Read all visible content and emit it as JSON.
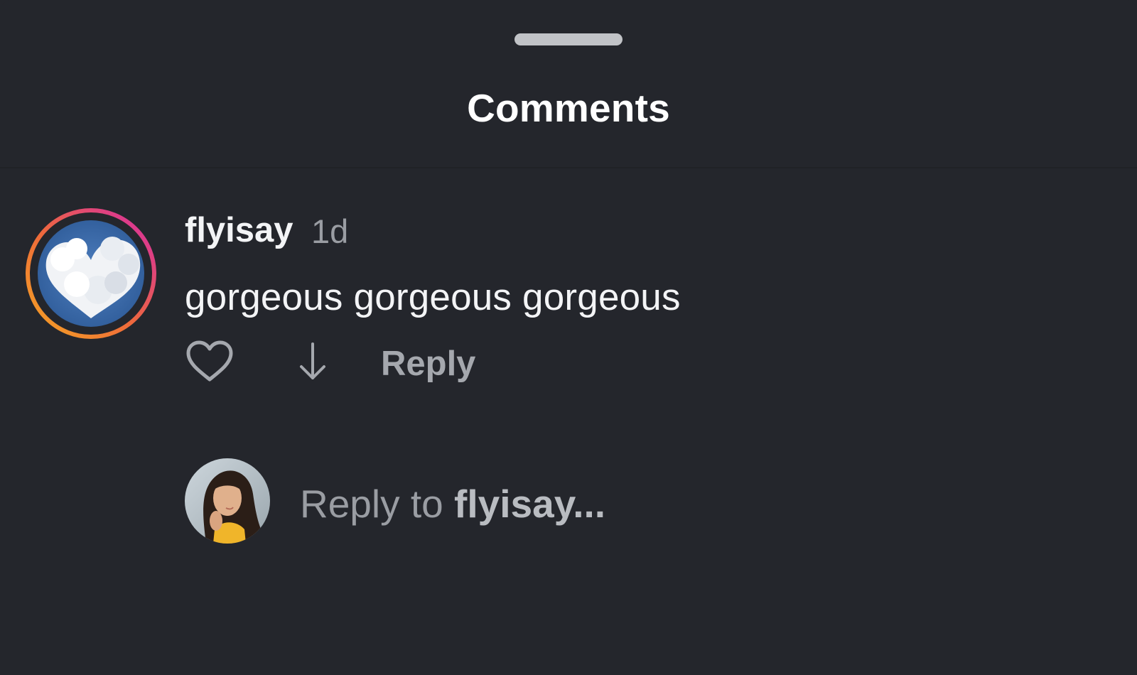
{
  "header": {
    "title": "Comments"
  },
  "comment": {
    "username": "flyisay",
    "time": "1d",
    "text": "gorgeous gorgeous gorgeous",
    "avatar_icon": "heart-cloud-avatar",
    "like_icon": "heart-outline-icon",
    "downvote_icon": "arrow-down-icon",
    "reply_label": "Reply"
  },
  "composer": {
    "prefix": "Reply to ",
    "target": "flyisay",
    "suffix": "..."
  },
  "colors": {
    "background": "#24262c",
    "text_primary": "#f3f4f6",
    "text_secondary": "#9a9da3",
    "story_ring_start": "#f5a623",
    "story_ring_end": "#d62aa8"
  }
}
